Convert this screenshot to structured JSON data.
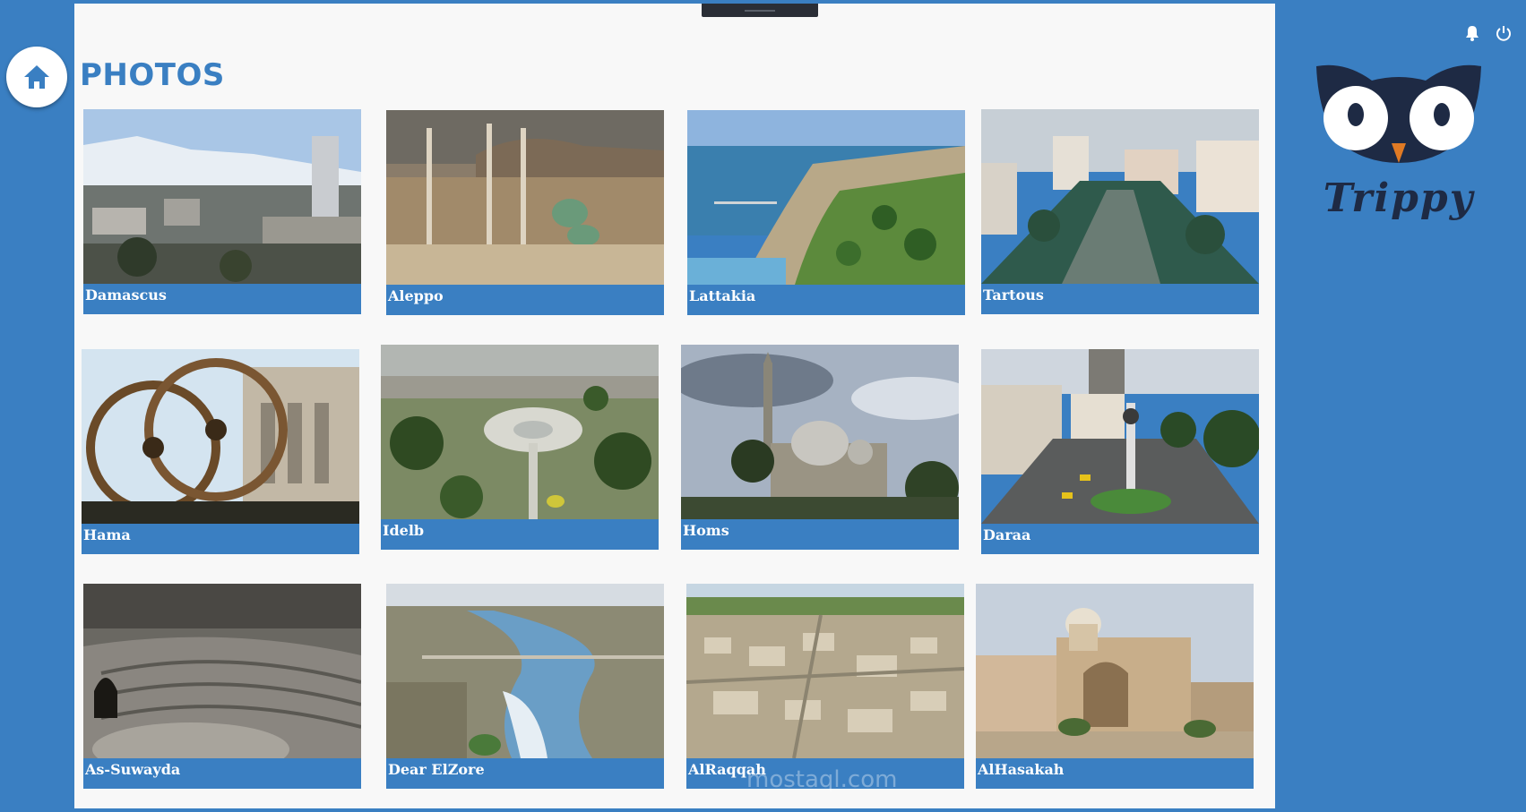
{
  "page": {
    "title": "PHOTOS"
  },
  "photos": [
    {
      "name": "Damascus"
    },
    {
      "name": "Aleppo"
    },
    {
      "name": "Lattakia"
    },
    {
      "name": "Tartous"
    },
    {
      "name": "Hama"
    },
    {
      "name": "Idelb"
    },
    {
      "name": "Homs"
    },
    {
      "name": "Daraa"
    },
    {
      "name": "As-Suwayda"
    },
    {
      "name": "Dear ElZore"
    },
    {
      "name": "AlRaqqah"
    },
    {
      "name": "AlHasakah"
    }
  ],
  "brand": {
    "name": "Trippy"
  },
  "icons": {
    "home": "home-icon",
    "notifications": "bell-icon",
    "power": "power-icon"
  },
  "watermark": "mostaql.com",
  "colors": {
    "accent": "#3a7fc2",
    "background": "#f8f8f8",
    "caption_text": "#ffffff"
  }
}
